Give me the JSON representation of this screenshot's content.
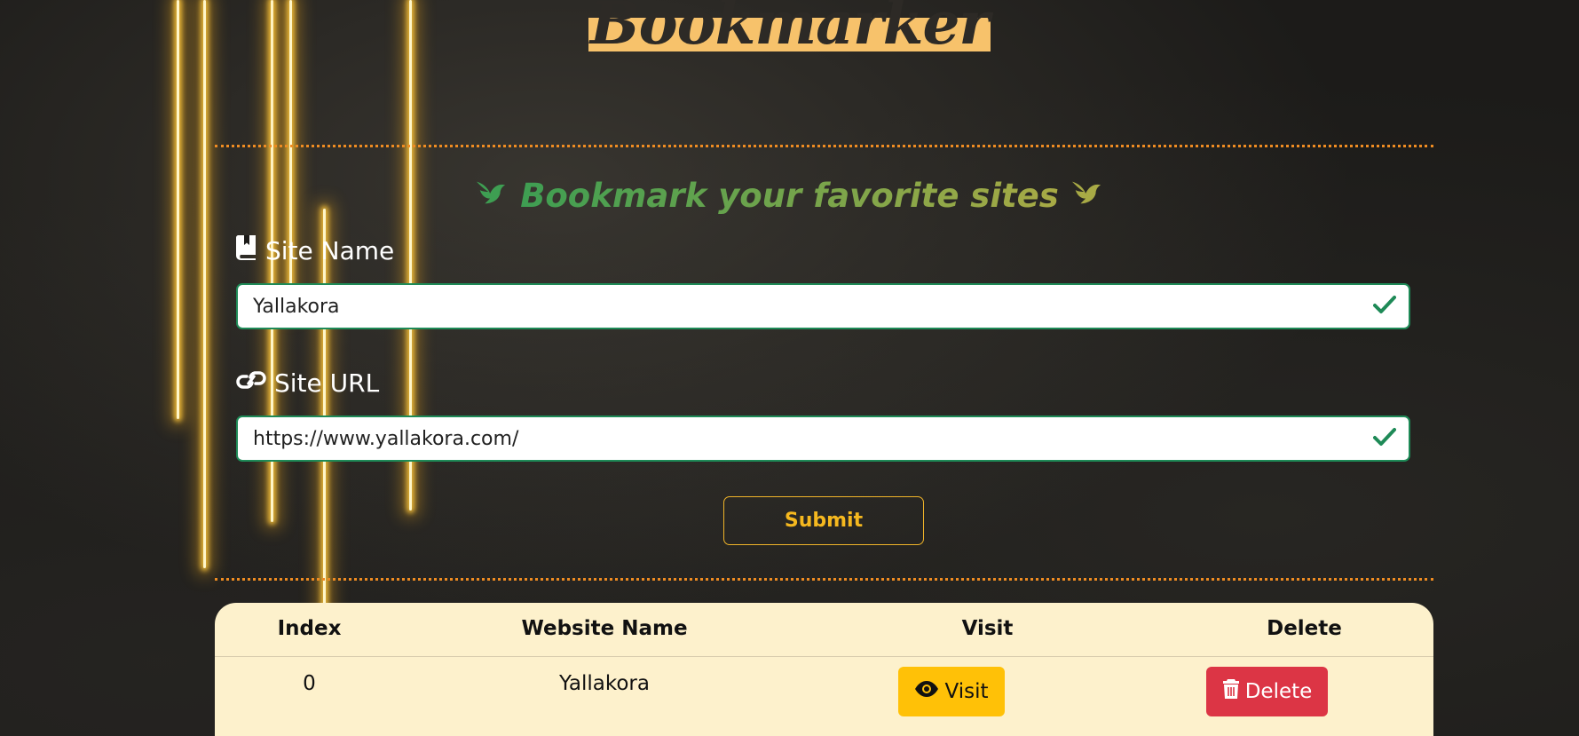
{
  "header": {
    "title": "Bookmarker"
  },
  "form": {
    "subtitle": "Bookmark your favorite sites",
    "site_name": {
      "label": "Site Name",
      "value": "Yallakora",
      "icon": "book-bookmark-icon",
      "status_icon": "check-icon"
    },
    "site_url": {
      "label": "Site URL",
      "value": "https://www.yallakora.com/",
      "icon": "link-icon",
      "status_icon": "check-icon"
    },
    "submit_label": "Submit"
  },
  "table": {
    "headers": [
      "Index",
      "Website Name",
      "Visit",
      "Delete"
    ],
    "rows": [
      {
        "index": "0",
        "name": "Yallakora",
        "visit_label": "Visit",
        "delete_label": "Delete"
      }
    ]
  },
  "colors": {
    "accent": "#f7c26b",
    "divider": "#ef8c22",
    "valid": "#1e8a57",
    "visit_button": "#ffc107",
    "delete_button": "#dc3545",
    "table_bg": "#fdf1cc"
  }
}
